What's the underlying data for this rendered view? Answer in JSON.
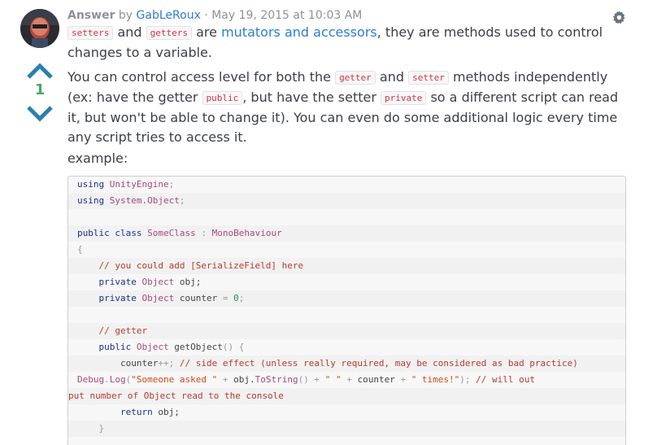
{
  "header": {
    "label": "Answer",
    "by": "by",
    "author": "GabLeRoux",
    "separator": "·",
    "timestamp": "May 19, 2015 at 10:03 AM",
    "gear_icon": "gear-icon"
  },
  "votes": {
    "count": "1",
    "up_icon": "chevron-up-icon",
    "down_icon": "chevron-down-icon"
  },
  "paragraph1": {
    "code1": "setters",
    "t1": "and",
    "code2": "getters",
    "t2": "are",
    "link": "mutators and accessors",
    "t3": ", they are methods used to control changes to a variable."
  },
  "paragraph2": {
    "t1": "You can control access level for both the",
    "code1": "getter",
    "t2": "and",
    "code2": "setter",
    "t3": "methods independently (ex: have the getter",
    "code3": "public",
    "t4": ", but have the setter",
    "code4": "private",
    "t5": "so a different script can read it, but won't be able to change it). You can even do some additional logic every time any script tries to access it."
  },
  "paragraph3": {
    "text": "example:"
  },
  "code": {
    "l1_kw": "using",
    "l1_ty": "UnityEngine",
    "l1_end": ";",
    "l2_kw": "using",
    "l2_ty": "System.Object",
    "l2_end": ";",
    "l4_kw1": "public",
    "l4_kw2": "class",
    "l4_ty1": "SomeClass",
    "l4_colon": ":",
    "l4_ty2": "MonoBehaviour",
    "l5": "{",
    "l6_cm": "// you could add [SerializeField] here",
    "l7_kw": "private",
    "l7_ty": "Object",
    "l7_rest": "obj;",
    "l8_kw": "private",
    "l8_ty": "Object",
    "l8_rest": "counter",
    "l8_eq": "=",
    "l8_num": "0",
    "l8_end": ";",
    "l10_cm": "// getter",
    "l11_kw": "public",
    "l11_ty": "Object",
    "l11_rest": "getObject",
    "l11_paren": "()",
    "l11_brace": "{",
    "l12_rest": "counter",
    "l12_op": "++;",
    "l12_cm": "// side effect (unless really required, may be considered as bad practice)",
    "l13_ty": "Debug",
    "l13_dot": ".",
    "l13_fn": "Log",
    "l13_open": "(",
    "l13_s1": "\"Someone asked \"",
    "l13_p1": "+",
    "l13_obj": "obj.",
    "l13_fn2": "ToString",
    "l13_paren": "()",
    "l13_p2": "+",
    "l13_s2": "\" \"",
    "l13_p3": "+",
    "l13_c": "counter",
    "l13_p4": "+",
    "l13_s3": "\" times!\"",
    "l13_close": ");",
    "l13_cm": "// will out",
    "l14_cm": "put number of Object read to the console",
    "l15_kw": "return",
    "l15_rest": "obj;",
    "l16": "}"
  }
}
